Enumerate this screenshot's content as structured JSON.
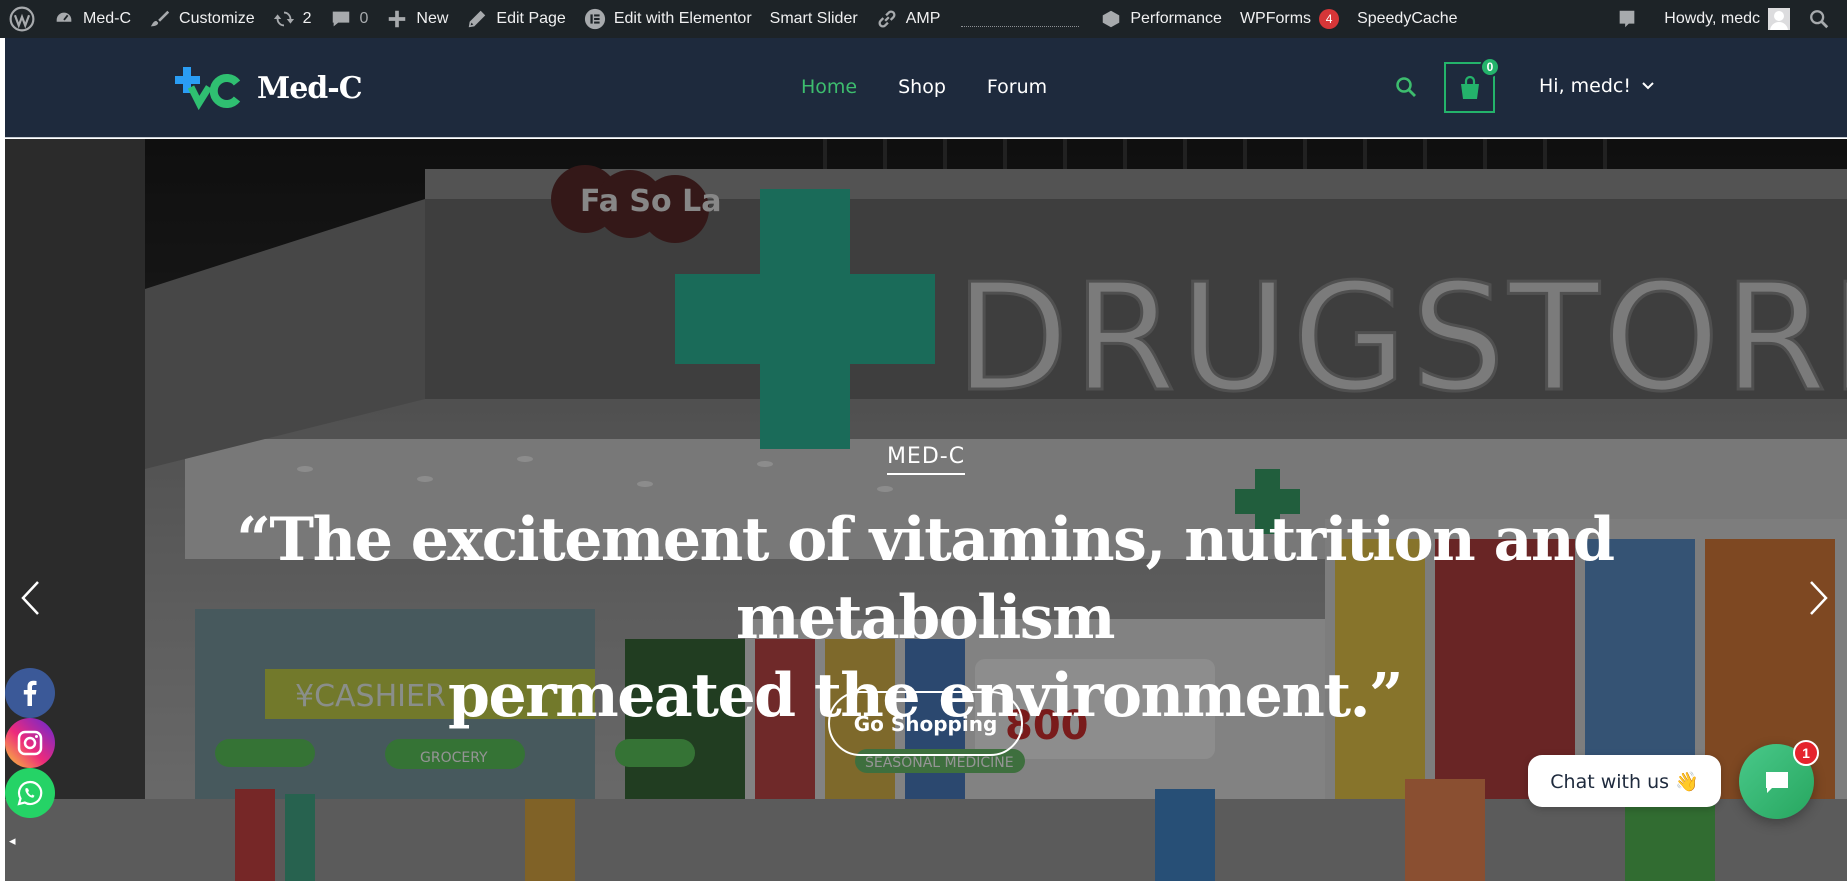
{
  "admin_bar": {
    "site_name": "Med-C",
    "customize": "Customize",
    "updates_count": "2",
    "comments_count": "0",
    "new": "New",
    "edit_page": "Edit Page",
    "elementor": "Edit with Elementor",
    "smart_slider": "Smart Slider",
    "amp": "AMP",
    "performance": "Performance",
    "wpforms": "WPForms",
    "wpforms_count": "4",
    "speedycache": "SpeedyCache",
    "howdy": "Howdy, medc"
  },
  "header": {
    "logo_text": "Med-C",
    "nav": [
      {
        "label": "Home",
        "active": true
      },
      {
        "label": "Shop",
        "active": false
      },
      {
        "label": "Forum",
        "active": false
      }
    ],
    "cart_count": "0",
    "user_greeting": "Hi, medc!",
    "accent_color": "#3dbd6e"
  },
  "hero": {
    "eyebrow": "MED-C",
    "quote_line1": "“The excitement of vitamins, nutrition and metabolism",
    "quote_line2": "permeated the environment.”",
    "button": "Go Shopping",
    "sign_brand": "DRUGSTORE",
    "sign_sub": "Fa So La",
    "cashier": "¥CASHIER",
    "grocery": "GROCERY",
    "seasonal": "SEASONAL MEDICINE",
    "price": "800"
  },
  "chat": {
    "label": "Chat with us 👋",
    "badge": "1"
  }
}
